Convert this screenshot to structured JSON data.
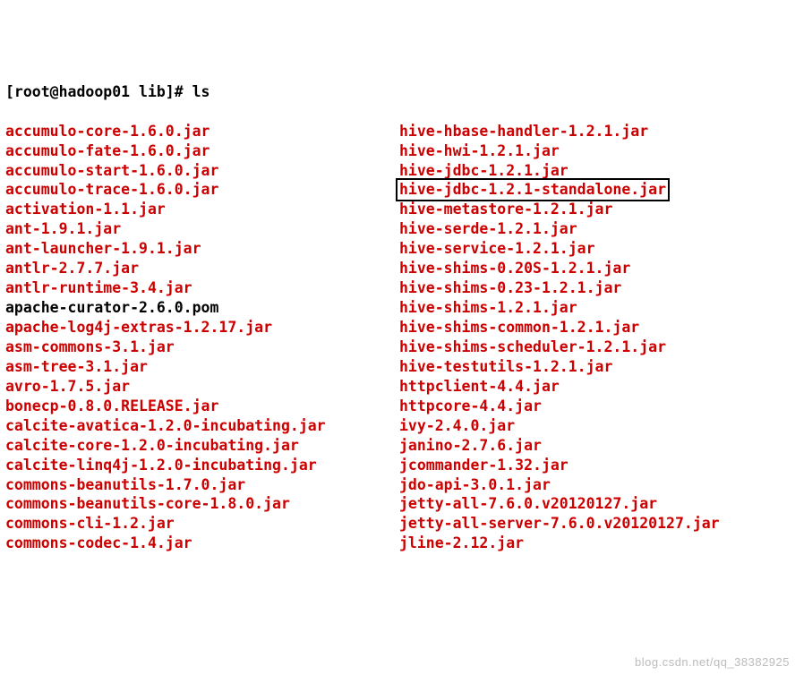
{
  "prompt": "[root@hadoop01 lib]# ls",
  "watermark": "blog.csdn.net/qq_38382925",
  "rows": [
    {
      "left": {
        "cls": "file",
        "text": "accumulo-core-1.6.0.jar"
      },
      "right": {
        "cls": "file",
        "text": "hive-hbase-handler-1.2.1.jar"
      }
    },
    {
      "left": {
        "cls": "file",
        "text": "accumulo-fate-1.6.0.jar"
      },
      "right": {
        "cls": "file",
        "text": "hive-hwi-1.2.1.jar"
      }
    },
    {
      "left": {
        "cls": "file",
        "text": "accumulo-start-1.6.0.jar"
      },
      "right": {
        "cls": "file",
        "text": "hive-jdbc-1.2.1.jar"
      }
    },
    {
      "left": {
        "cls": "file",
        "text": "accumulo-trace-1.6.0.jar"
      },
      "right": {
        "cls": "file",
        "text": "hive-jdbc-1.2.1-standalone.jar",
        "boxed": true
      }
    },
    {
      "left": {
        "cls": "file",
        "text": "activation-1.1.jar"
      },
      "right": {
        "cls": "file",
        "text": "hive-metastore-1.2.1.jar"
      }
    },
    {
      "left": {
        "cls": "file",
        "text": "ant-1.9.1.jar"
      },
      "right": {
        "cls": "file",
        "text": "hive-serde-1.2.1.jar"
      }
    },
    {
      "left": {
        "cls": "file",
        "text": "ant-launcher-1.9.1.jar"
      },
      "right": {
        "cls": "file",
        "text": "hive-service-1.2.1.jar"
      }
    },
    {
      "left": {
        "cls": "file",
        "text": "antlr-2.7.7.jar"
      },
      "right": {
        "cls": "file",
        "text": "hive-shims-0.20S-1.2.1.jar"
      }
    },
    {
      "left": {
        "cls": "file",
        "text": "antlr-runtime-3.4.jar"
      },
      "right": {
        "cls": "file",
        "text": "hive-shims-0.23-1.2.1.jar"
      }
    },
    {
      "left": {
        "cls": "plain",
        "text": "apache-curator-2.6.0.pom"
      },
      "right": {
        "cls": "file",
        "text": "hive-shims-1.2.1.jar"
      }
    },
    {
      "left": {
        "cls": "file",
        "text": "apache-log4j-extras-1.2.17.jar"
      },
      "right": {
        "cls": "file",
        "text": "hive-shims-common-1.2.1.jar"
      }
    },
    {
      "left": {
        "cls": "file",
        "text": "asm-commons-3.1.jar"
      },
      "right": {
        "cls": "file",
        "text": "hive-shims-scheduler-1.2.1.jar"
      }
    },
    {
      "left": {
        "cls": "file",
        "text": "asm-tree-3.1.jar"
      },
      "right": {
        "cls": "file",
        "text": "hive-testutils-1.2.1.jar"
      }
    },
    {
      "left": {
        "cls": "file",
        "text": "avro-1.7.5.jar"
      },
      "right": {
        "cls": "file",
        "text": "httpclient-4.4.jar"
      }
    },
    {
      "left": {
        "cls": "file",
        "text": "bonecp-0.8.0.RELEASE.jar"
      },
      "right": {
        "cls": "file",
        "text": "httpcore-4.4.jar"
      }
    },
    {
      "left": {
        "cls": "file",
        "text": "calcite-avatica-1.2.0-incubating.jar"
      },
      "right": {
        "cls": "file",
        "text": "ivy-2.4.0.jar"
      }
    },
    {
      "left": {
        "cls": "file",
        "text": "calcite-core-1.2.0-incubating.jar"
      },
      "right": {
        "cls": "file",
        "text": "janino-2.7.6.jar"
      }
    },
    {
      "left": {
        "cls": "file",
        "text": "calcite-linq4j-1.2.0-incubating.jar"
      },
      "right": {
        "cls": "file",
        "text": "jcommander-1.32.jar"
      }
    },
    {
      "left": {
        "cls": "file",
        "text": "commons-beanutils-1.7.0.jar"
      },
      "right": {
        "cls": "file",
        "text": "jdo-api-3.0.1.jar"
      }
    },
    {
      "left": {
        "cls": "file",
        "text": "commons-beanutils-core-1.8.0.jar"
      },
      "right": {
        "cls": "file",
        "text": "jetty-all-7.6.0.v20120127.jar"
      }
    },
    {
      "left": {
        "cls": "file",
        "text": "commons-cli-1.2.jar"
      },
      "right": {
        "cls": "file",
        "text": "jetty-all-server-7.6.0.v20120127.jar"
      }
    },
    {
      "left": {
        "cls": "file",
        "text": "commons-codec-1.4.jar"
      },
      "right": {
        "cls": "file",
        "text": "jline-2.12.jar"
      }
    }
  ]
}
